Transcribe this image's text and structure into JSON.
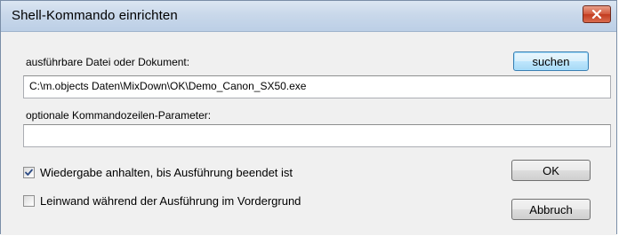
{
  "window": {
    "title": "Shell-Kommando einrichten"
  },
  "form": {
    "file_label": "ausführbare Datei oder Dokument:",
    "file_value": "C:\\m.objects Daten\\MixDown\\OK\\Demo_Canon_SX50.exe",
    "browse_label": "suchen",
    "params_label": "optionale Kommandozeilen-Parameter:",
    "params_value": "",
    "pause_label": "Wiedergabe anhalten, bis Ausführung beendet ist",
    "pause_checked": true,
    "foreground_label": "Leinwand während der Ausführung im Vordergrund",
    "foreground_checked": false
  },
  "buttons": {
    "ok_label": "OK",
    "cancel_label": "Abbruch"
  },
  "icons": {
    "close": "close-x-icon",
    "check": "checkmark-icon"
  }
}
